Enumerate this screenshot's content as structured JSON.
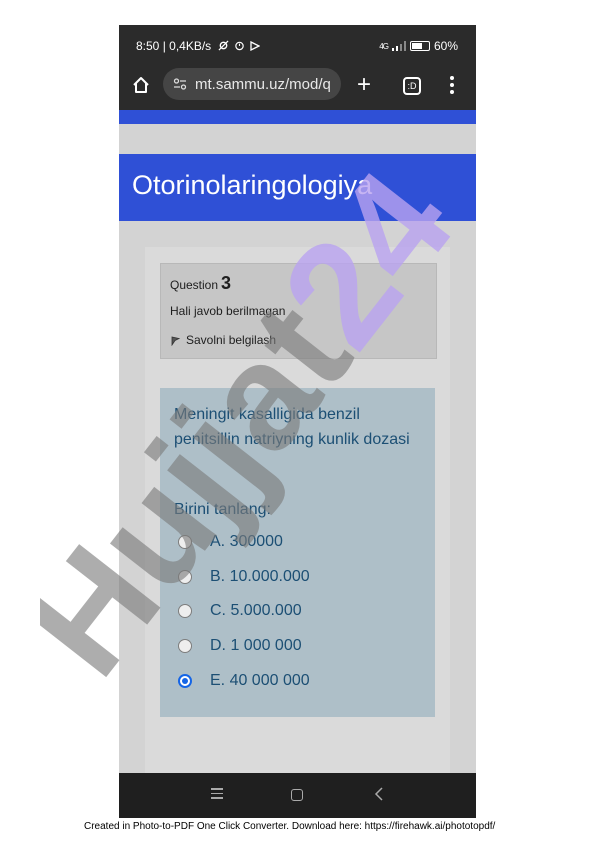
{
  "status_bar": {
    "time_and_speed": "8:50 | 0,4KB/s",
    "network": "4G",
    "battery": "60%"
  },
  "browser": {
    "url": "mt.sammu.uz/mod/q",
    "new_tab_symbol": "+",
    "tabs_count": ":D"
  },
  "course": {
    "title": "Otorinolaringologiya"
  },
  "question_info": {
    "label": "Question",
    "number": "3",
    "state": "Hali javob berilmagan",
    "flag_label": "Savolni belgilash"
  },
  "question": {
    "text": "Meningit kasalligida benzil penitsillin natriyning kunlik dozasi",
    "prompt": "Birini tanlang:",
    "answers": [
      {
        "label": "A. 300000",
        "selected": false
      },
      {
        "label": "B. 10.000.000",
        "selected": false
      },
      {
        "label": "C. 5.000.000",
        "selected": false
      },
      {
        "label": "D. 1 000 000",
        "selected": false
      },
      {
        "label": "E. 40 000 000",
        "selected": true
      }
    ]
  },
  "watermark": {
    "text": "Hujjat24"
  },
  "footer": {
    "text": "Created in Photo-to-PDF One Click Converter. Download here: https://firehawk.ai/phototopdf/"
  },
  "colors": {
    "accent_blue": "#2f50d6",
    "question_text": "#1c4f74",
    "radio_checked": "#1565e6"
  }
}
